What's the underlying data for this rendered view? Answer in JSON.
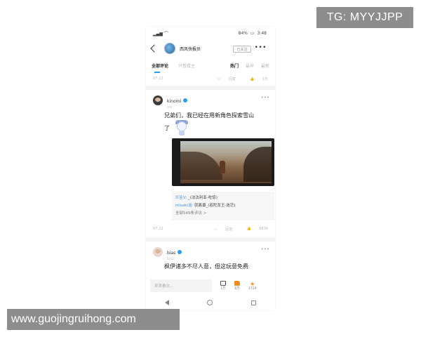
{
  "overlays": {
    "tg_label": "TG: MYYJJPP",
    "watermark": "www.guojingruihong.com"
  },
  "statusbar": {
    "signal_text": "▂▄▆ ⌒",
    "battery": "84%",
    "time": "3:48"
  },
  "topbar": {
    "topic_name": "西风快报员",
    "followed_label": "已关注",
    "more_icon": "more-horizontal-icon"
  },
  "tabs": {
    "items": [
      "全部评论",
      "只看楼主"
    ],
    "active_index": 0,
    "sort": [
      "热门",
      "最早",
      "最新"
    ],
    "active_sort_index": 0
  },
  "prev_row": {
    "date": "07-22",
    "reply_label": "回复",
    "like_count": "1万"
  },
  "post1": {
    "username": "kinomi",
    "level": "LV9",
    "text_line1": "兄弟们，我已经在用新角色探索雪山",
    "text_line2": "了",
    "replies": [
      {
        "name": "乐生V:",
        "text": " _(法法利亚-吃惊)"
      },
      {
        "name": "misaki泡:",
        "text": " 就离谱_(若陀龙王-迷茫)"
      }
    ],
    "all_replies": "全部549条评论 >",
    "date": "07-22",
    "reply_label": "回复",
    "like_count": "8634"
  },
  "post2": {
    "username": "bias",
    "level": "LV10",
    "text": "枫伊诸多不尽人意，但这玩意免费"
  },
  "bottombar": {
    "input_placeholder": "发表看法...",
    "comment_count": "1万",
    "like_count": "6万",
    "fav_count": "2729"
  },
  "colors": {
    "accent": "#2a9df4",
    "like": "#f08a24"
  }
}
